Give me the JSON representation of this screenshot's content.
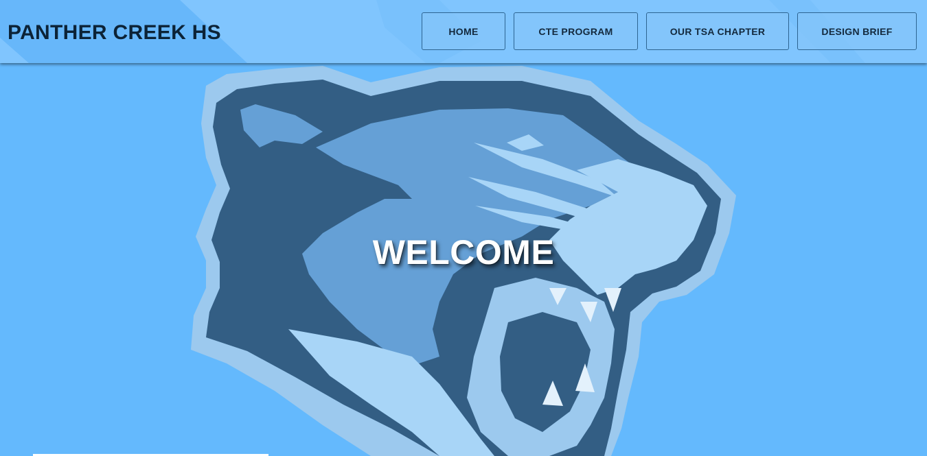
{
  "header": {
    "brand": "PANTHER CREEK HS",
    "nav": [
      {
        "label": "HOME"
      },
      {
        "label": "CTE PROGRAM"
      },
      {
        "label": "OUR TSA CHAPTER"
      },
      {
        "label": "DESIGN BRIEF"
      }
    ]
  },
  "hero": {
    "heading": "WELCOME",
    "image": "panther-mascot-logo"
  },
  "colors": {
    "background": "#64b9fd",
    "navbar": "#80c5fe",
    "panther_dark": "#335e84",
    "panther_mid": "#65a0d6",
    "panther_light": "#a8d5f7",
    "panther_outline": "#9cc9ee"
  }
}
